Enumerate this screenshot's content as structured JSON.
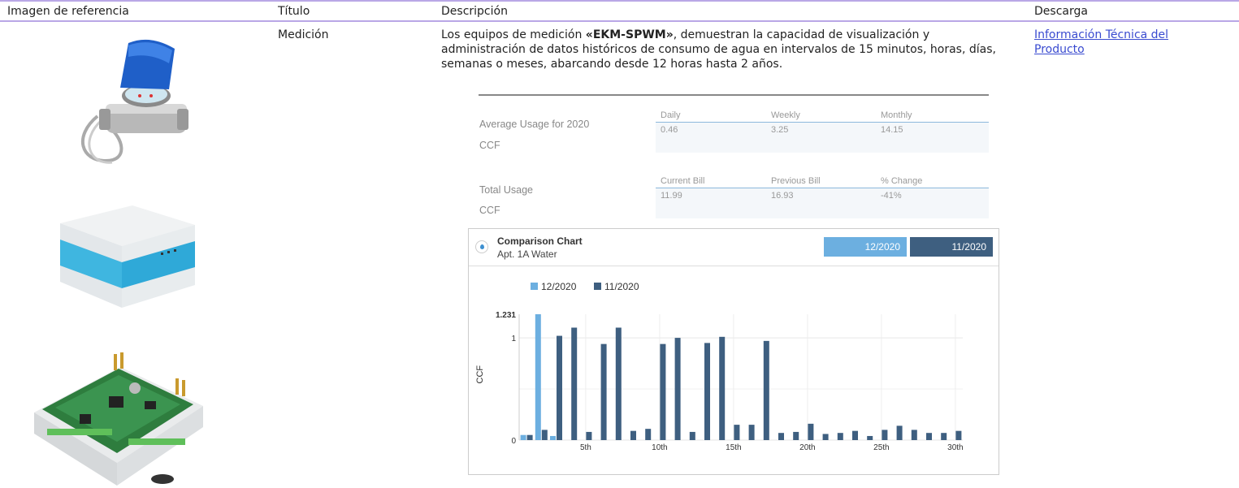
{
  "table": {
    "headers": {
      "image": "Imagen de referencia",
      "title": "Título",
      "description": "Descripción",
      "download": "Descarga"
    },
    "row": {
      "title": "Medición",
      "description_prefix": "Los equipos de medición ",
      "description_bold": "«EKM-SPWM»",
      "description_suffix": ", demuestran la capacidad de visualización y administración de datos históricos de consumo de agua en intervalos de 15 minutos, horas, días, semanas o meses, abarcando desde 12 horas hasta 2 años.",
      "download_link": "Información Técnica del Producto"
    }
  },
  "usage": {
    "average": {
      "label": "Average Usage for 2020",
      "unit": "CCF",
      "headers": [
        "Daily",
        "Weekly",
        "Monthly"
      ],
      "values": [
        "0.46",
        "3.25",
        "14.15"
      ]
    },
    "total": {
      "label": "Total Usage",
      "unit": "CCF",
      "headers": [
        "Current Bill",
        "Previous Bill",
        "% Change"
      ],
      "values": [
        "11.99",
        "16.93",
        "-41%"
      ]
    }
  },
  "panel": {
    "title": "Comparison Chart",
    "subtitle": "Apt. 1A Water",
    "toggle_a": "12/2020",
    "toggle_b": "11/2020",
    "icon": "water-drop-icon"
  },
  "colors": {
    "series_a": "#6cafe0",
    "series_b": "#3e5f80",
    "accent": "#b9a7e6",
    "link": "#3a4bd0"
  },
  "chart_data": {
    "type": "bar",
    "ylabel": "CCF",
    "xlabel": "",
    "ylim": [
      0,
      1.231
    ],
    "y_ticks": [
      "0",
      "1",
      "1.231"
    ],
    "x_tick_labels": [
      "5th",
      "10th",
      "15th",
      "20th",
      "25th",
      "30th"
    ],
    "legend": "top-left",
    "categories": [
      1,
      2,
      3,
      4,
      5,
      6,
      7,
      8,
      9,
      10,
      11,
      12,
      13,
      14,
      15,
      16,
      17,
      18,
      19,
      20,
      21,
      22,
      23,
      24,
      25,
      26,
      27,
      28,
      29,
      30
    ],
    "series": [
      {
        "name": "12/2020",
        "values": [
          0.05,
          1.231,
          0.04,
          0,
          0,
          0,
          0,
          0,
          0,
          0,
          0,
          0,
          0,
          0,
          0,
          0,
          0,
          0,
          0,
          0,
          0,
          0,
          0,
          0,
          0,
          0,
          0,
          0,
          0,
          0
        ]
      },
      {
        "name": "11/2020",
        "values": [
          0.05,
          0.1,
          1.02,
          1.1,
          0.08,
          0.94,
          1.1,
          0.09,
          0.11,
          0.94,
          1.0,
          0.08,
          0.95,
          1.01,
          0.15,
          0.15,
          0.97,
          0.07,
          0.08,
          0.16,
          0.06,
          0.07,
          0.09,
          0.04,
          0.1,
          0.14,
          0.1,
          0.07,
          0.07,
          0.09
        ]
      }
    ]
  }
}
